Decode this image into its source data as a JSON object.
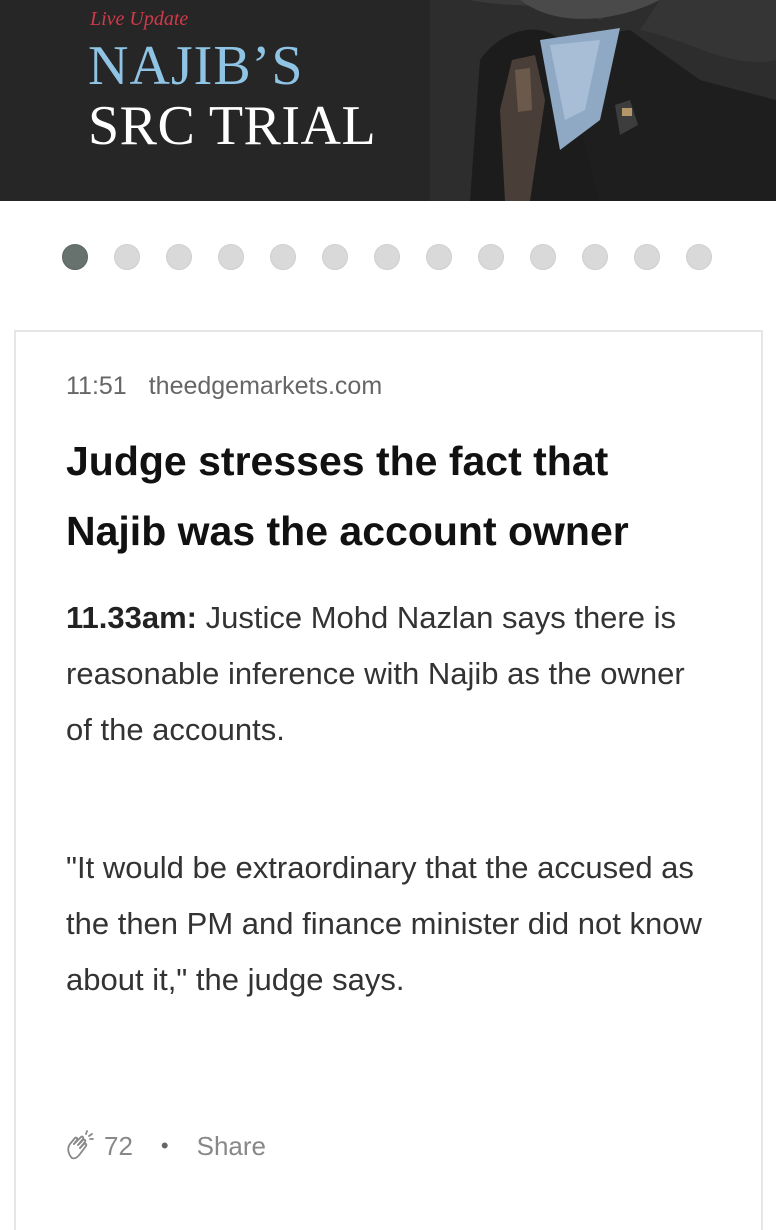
{
  "banner": {
    "live_label": "Live Update",
    "title_line1": "NAJIB’S",
    "title_line2": "SRC TRIAL"
  },
  "carousel": {
    "total_dots": 13,
    "active_index": 0
  },
  "post": {
    "time": "11:51",
    "source": "theedgemarkets.com",
    "headline": "Judge stresses the fact that Najib was the account owner",
    "para1_time": "11.33am:",
    "para1_text": " Justice Mohd Nazlan says there is reasonable inference with Najib as the owner of the accounts.",
    "para2_text": "\"It would be extraordinary that the accused as the then PM and finance minister did not know about it,\" the judge says."
  },
  "footer": {
    "clap_icon": "clap-icon",
    "clap_count": "72",
    "separator": "•",
    "share_label": "Share"
  },
  "colors": {
    "banner_bg": "#262626",
    "live_label": "#cf3b4a",
    "title_accent": "#8fc4e4",
    "active_dot": "#67726f",
    "inactive_dot": "#d9d9d9"
  }
}
